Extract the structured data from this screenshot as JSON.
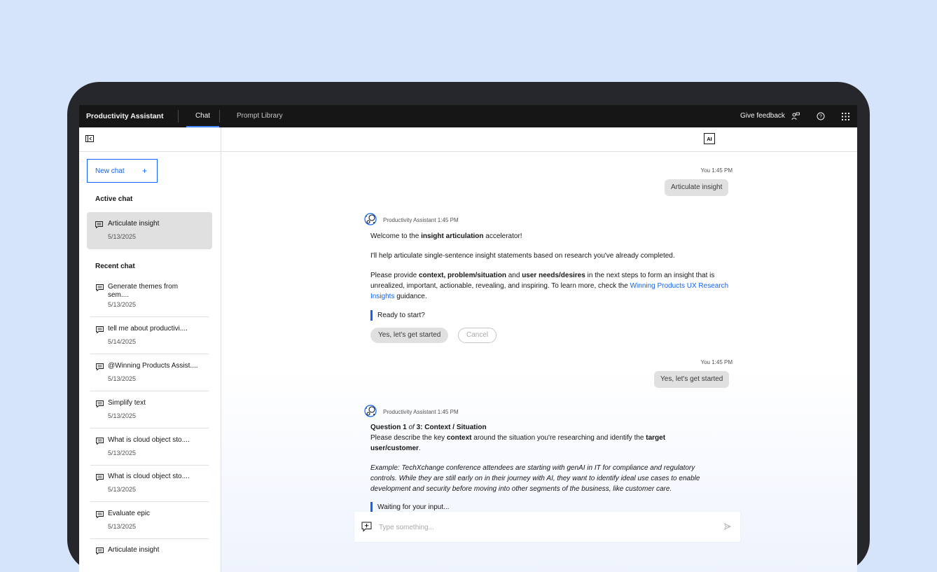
{
  "header": {
    "brand": "Productivity Assistant",
    "tabs": [
      {
        "label": "Chat",
        "active": true
      },
      {
        "label": "Prompt Library",
        "active": false
      }
    ],
    "feedback_label": "Give feedback"
  },
  "sidebar": {
    "new_chat_label": "New chat",
    "new_chat_plus": "+",
    "active_title": "Active chat",
    "active_chat": {
      "title": "Articulate insight",
      "date": "5/13/2025"
    },
    "recent_title": "Recent chat",
    "recent": [
      {
        "title": "Generate themes from",
        "title2": "sem....",
        "date": "5/13/2025"
      },
      {
        "title": "tell me about productivi....",
        "date": "5/14/2025"
      },
      {
        "title": "@Winning Products Assist....",
        "date": "5/13/2025"
      },
      {
        "title": "Simplify text",
        "date": "5/13/2025"
      },
      {
        "title": "What is cloud object sto....",
        "date": "5/13/2025"
      },
      {
        "title": "What is cloud object sto....",
        "date": "5/13/2025"
      },
      {
        "title": "Evaluate epic",
        "date": "5/13/2025"
      },
      {
        "title": "Articulate insight",
        "date": ""
      }
    ]
  },
  "main": {
    "ai_label": "AI",
    "msg1": {
      "meta": "You 1:45 PM",
      "text": "Articulate insight"
    },
    "bot1": {
      "meta": "Productivity Assistant 1:45 PM",
      "welcome_pre": "Welcome to the ",
      "welcome_bold": "insight articulation",
      "welcome_post": " accelerator!",
      "help": "I'll help articulate single-sentence insight statements based on research you've already completed.",
      "provide_1": "Please provide ",
      "provide_b1": "context, problem/situation",
      "provide_2": " and ",
      "provide_b2": "user needs/desires",
      "provide_3": " in the next steps to form an insight that is unrealized, important, actionable, revealing, and inspiring. To learn more, check the ",
      "provide_link": "Winning Products UX Research Insights",
      "provide_4": " guidance.",
      "ready": "Ready to start?",
      "btn_yes": "Yes, let's get started",
      "btn_cancel": "Cancel"
    },
    "msg2": {
      "meta": "You 1:45 PM",
      "text": "Yes, let's get started"
    },
    "bot2": {
      "meta": "Productivity Assistant 1:45 PM",
      "q_b1": "Question 1",
      "q_i": " of ",
      "q_b2": "3: Context / Situation",
      "desc_1": "Please describe the key ",
      "desc_b1": "context",
      "desc_2": " around the situation you're researching and identify the ",
      "desc_b2": "target user/customer",
      "desc_3": ".",
      "example": "Example: TechXchange conference attendees are starting with genAI in IT for compliance and regulatory controls. While they are still early on in their journey with AI, they want to identify ideal use cases to enable development and security before moving into other segments of the business, like customer care.",
      "waiting": "Waiting for your input..."
    },
    "input_placeholder": "Type something..."
  }
}
